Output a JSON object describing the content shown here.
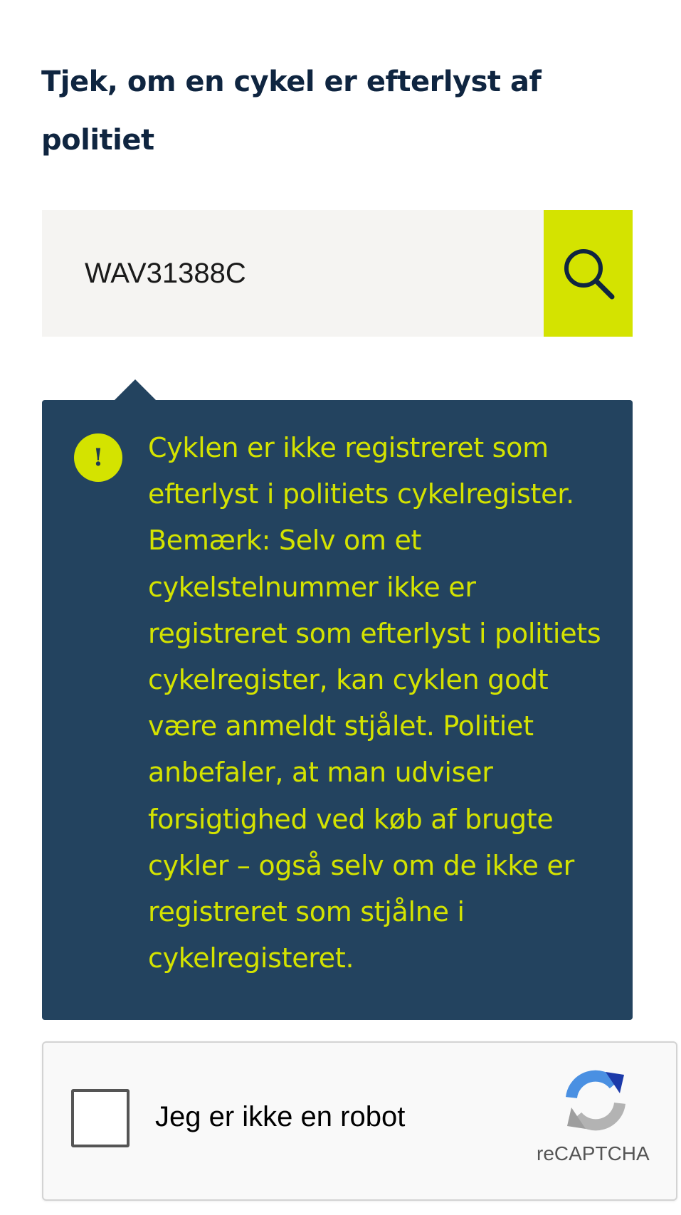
{
  "title": "Tjek, om en cykel er efterlyst af politiet",
  "search": {
    "value": "WAV31388C"
  },
  "result": {
    "icon": "warning-icon",
    "message": "Cyklen er ikke registreret som efterlyst i politiets cykelregister. Bemærk: Selv om et cykelstelnummer ikke er registreret som efterlyst i politiets cykelregister, kan cyklen godt være anmeldt stjålet. Politiet anbefaler, at man udviser forsigtighed ved køb af brugte cykler – også selv om de ikke er registreret som stjålne i cykelregisteret."
  },
  "recaptcha": {
    "label": "Jeg er ikke en robot",
    "brand": "reCAPTCHA",
    "checked": false
  },
  "colors": {
    "title": "#0f2540",
    "accent": "#d4e300",
    "panel_background": "#23435f",
    "input_background": "#f5f4f2"
  }
}
